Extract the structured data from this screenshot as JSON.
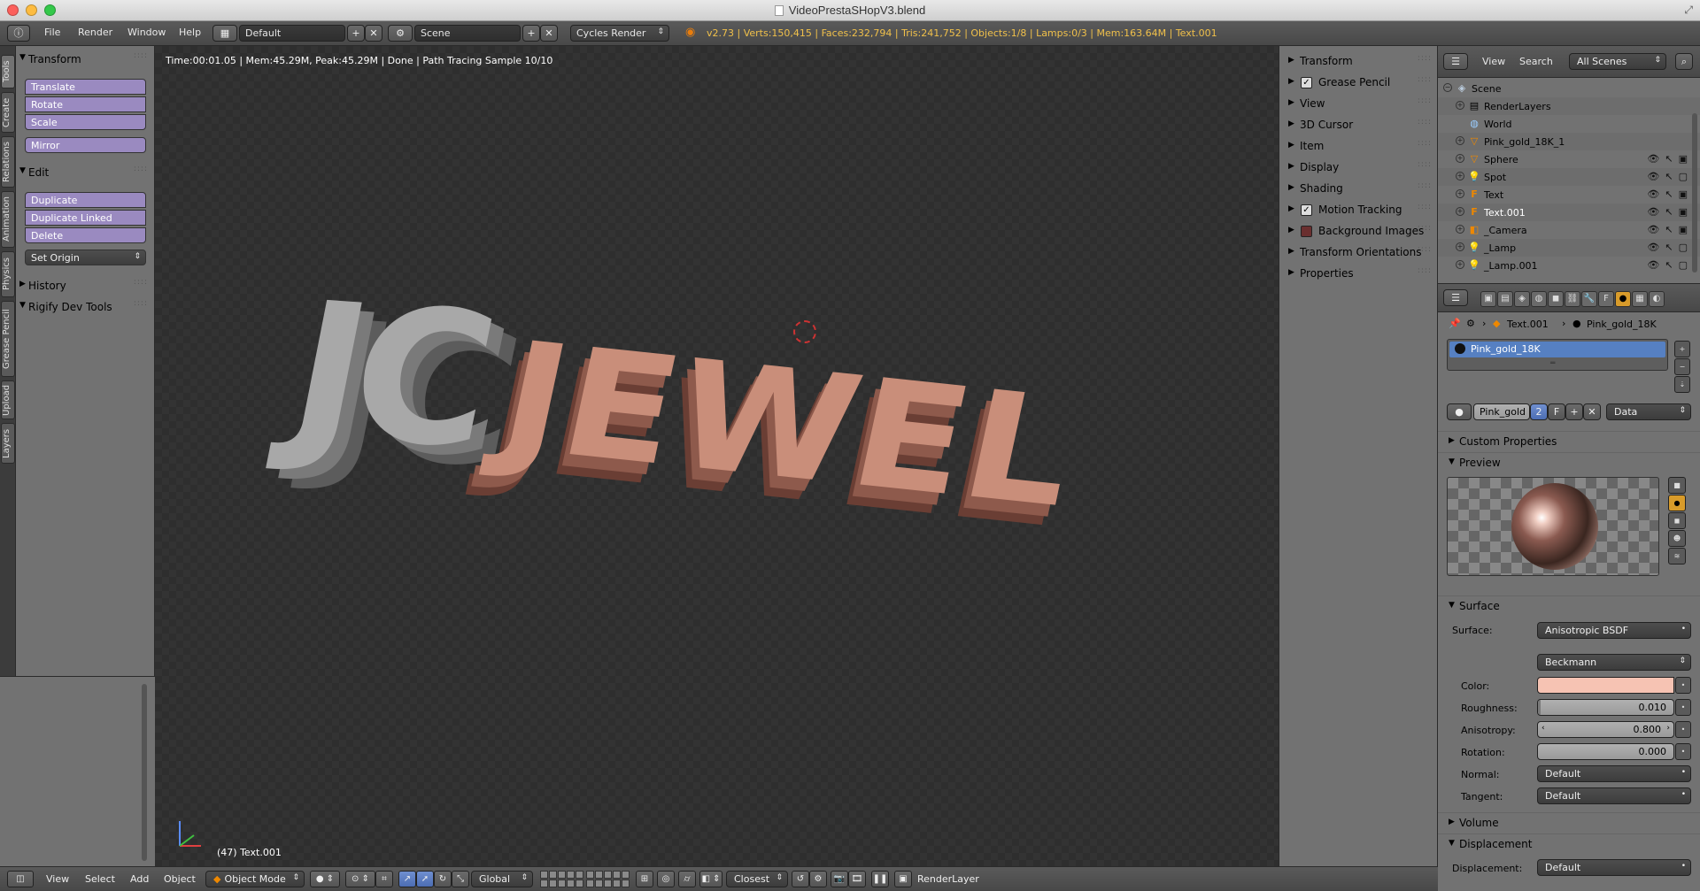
{
  "window": {
    "title": "VideoPrestaSHopV3.blend"
  },
  "info_header": {
    "menus": [
      "File",
      "Render",
      "Window",
      "Help"
    ],
    "layout": "Default",
    "scene": "Scene",
    "engine": "Cycles Render",
    "stats": "v2.73 | Verts:150,415 | Faces:232,794 | Tris:241,752 | Objects:1/8 | Lamps:0/3 | Mem:163.64M | Text.001"
  },
  "tool_tabs": [
    "Tools",
    "Create",
    "Relations",
    "Animation",
    "Physics",
    "Grease Pencil",
    "Upload",
    "Layers"
  ],
  "toolshelf": {
    "transform": {
      "title": "Transform",
      "buttons": [
        "Translate",
        "Rotate",
        "Scale"
      ],
      "mirror": "Mirror"
    },
    "edit": {
      "title": "Edit",
      "buttons": [
        "Duplicate",
        "Duplicate Linked",
        "Delete"
      ],
      "set_origin": "Set Origin"
    },
    "history": "History",
    "rigify": "Rigify Dev Tools"
  },
  "viewport": {
    "status": "Time:00:01.05 | Mem:45.29M, Peak:45.29M | Done | Path Tracing Sample 10/10",
    "object_label": "(47) Text.001",
    "render_text_1": "JC",
    "render_text_2": "JEWEL"
  },
  "npanel": {
    "rows": [
      "Transform",
      "Grease Pencil",
      "View",
      "3D Cursor",
      "Item",
      "Display",
      "Shading",
      "Motion Tracking",
      "Background Images",
      "Transform Orientations",
      "Properties"
    ]
  },
  "outliner": {
    "menus": [
      "View",
      "Search"
    ],
    "filter": "All Scenes",
    "items": [
      {
        "name": "Scene",
        "icon": "scene-icon"
      },
      {
        "name": "RenderLayers",
        "icon": "render-layers-icon"
      },
      {
        "name": "World",
        "icon": "world-icon"
      },
      {
        "name": "Pink_gold_18K_1",
        "icon": "mesh-icon"
      },
      {
        "name": "Sphere",
        "icon": "mesh-icon"
      },
      {
        "name": "Spot",
        "icon": "lamp-icon"
      },
      {
        "name": "Text",
        "icon": "text-icon"
      },
      {
        "name": "Text.001",
        "icon": "text-icon"
      },
      {
        "name": "_Camera",
        "icon": "camera-icon"
      },
      {
        "name": "_Lamp",
        "icon": "lamp-icon"
      },
      {
        "name": "_Lamp.001",
        "icon": "lamp-icon"
      }
    ]
  },
  "properties": {
    "breadcrumb_object": "Text.001",
    "breadcrumb_material": "Pink_gold_18K",
    "slot_name": "Pink_gold_18K",
    "material_field": "Pink_gold",
    "users": "2",
    "fake_user": "F",
    "link": "Data",
    "custom_properties": "Custom Properties",
    "preview": "Preview",
    "surface_section": "Surface",
    "surface_label": "Surface:",
    "surface_value": "Anisotropic BSDF",
    "distribution": "Beckmann",
    "color_label": "Color:",
    "color_value": "#f6c3b3",
    "roughness_label": "Roughness:",
    "roughness": "0.010",
    "anisotropy_label": "Anisotropy:",
    "anisotropy": "0.800",
    "rotation_label": "Rotation:",
    "rotation": "0.000",
    "normal_label": "Normal:",
    "normal": "Default",
    "tangent_label": "Tangent:",
    "tangent": "Default",
    "volume_section": "Volume",
    "displacement_section": "Displacement",
    "displacement_label": "Displacement:",
    "displacement": "Default"
  },
  "bottom_header": {
    "menus": [
      "View",
      "Select",
      "Add",
      "Object"
    ],
    "mode": "Object Mode",
    "orientation": "Global",
    "snap": "Closest",
    "render_layer": "RenderLayer"
  },
  "colors": {
    "tool_button": "#9a8ac0",
    "accent_orange": "#d89b2a",
    "stats_text": "#f0c04a"
  }
}
